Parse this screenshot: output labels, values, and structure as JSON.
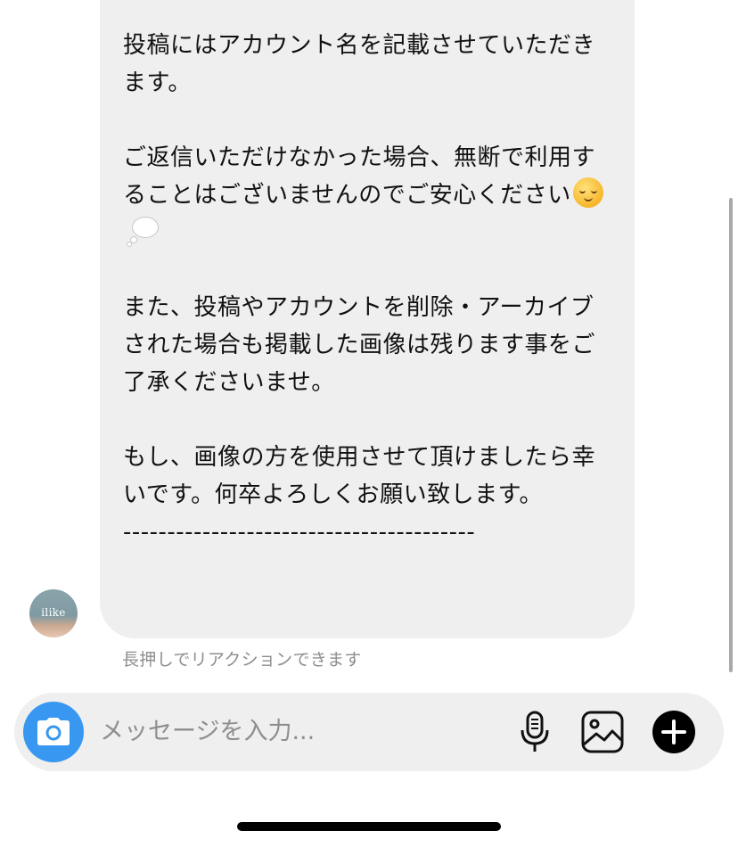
{
  "message": {
    "paragraphs": [
      "投稿にはアカウント名を記載させていただきます。",
      "ご返信いただけなかった場合、無断で利用することはございませんのでご安心ください",
      "また、投稿やアカウントを削除・アーカイブ された場合も掲載した画像は残ります事をご了承くださいませ。",
      "もし、画像の方を使用させて頂けましたら幸いです。何卒よろしくお願い致します。",
      "----------------------------------------"
    ],
    "emoji": [
      "relieved-face-emoji",
      "thought-balloon-emoji"
    ]
  },
  "avatar": {
    "text": "ilike"
  },
  "hint": "長押しでリアクションできます",
  "composer": {
    "placeholder": "メッセージを入力..."
  },
  "icons": {
    "camera": "camera-icon",
    "microphone": "microphone-icon",
    "gallery": "image-icon",
    "add": "plus-icon"
  },
  "colors": {
    "accent": "#3897f0",
    "bubble": "#efefef",
    "hint": "#8e8e8e"
  }
}
